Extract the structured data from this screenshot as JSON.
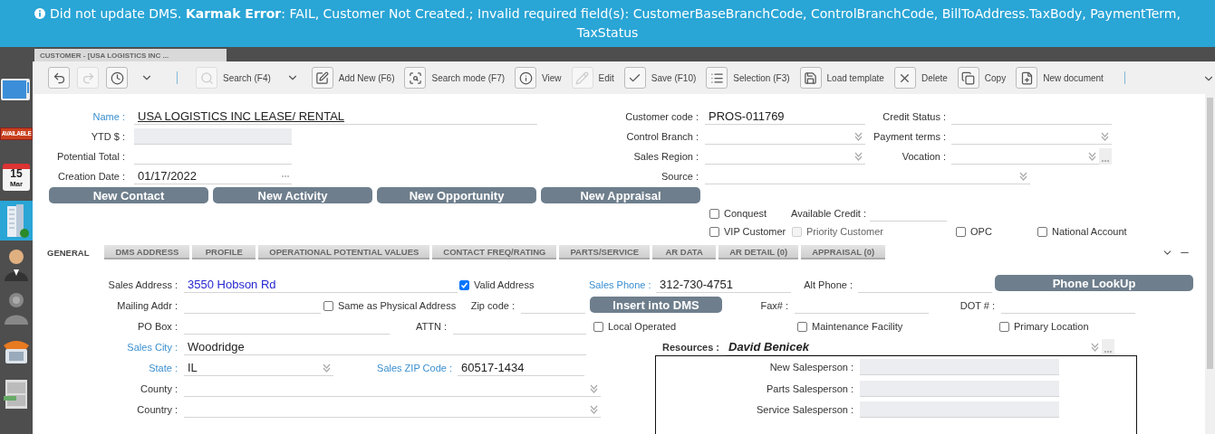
{
  "banner": {
    "message": "Did not update DMS. **Karmak Error**: FAIL, Customer Not Created.; Invalid required field(s): CustomerBaseBranchCode, ControlBranchCode, BillToAddress.TaxBody, PaymentTerm, TaxStatus"
  },
  "document_tab": {
    "title": "CUSTOMER - [USA LOGISTICS INC ..."
  },
  "sidebar": {
    "items": [
      {
        "kind": "monitor",
        "selected": false
      },
      {
        "kind": "sign",
        "text": "AVAILABLE",
        "selected": false
      },
      {
        "kind": "calendar",
        "day": "15",
        "month": "Mar",
        "selected": false
      },
      {
        "kind": "building",
        "selected": true
      },
      {
        "kind": "person",
        "selected": false
      },
      {
        "kind": "help",
        "selected": false
      },
      {
        "kind": "phone",
        "selected": false
      },
      {
        "kind": "cabinet",
        "selected": false
      }
    ]
  },
  "toolbar": {
    "items": [
      {
        "kind": "icon",
        "disabled": false
      },
      {
        "kind": "icon",
        "disabled": true
      },
      {
        "kind": "icon",
        "disabled": false
      },
      {
        "kind": "dropdown"
      },
      {
        "kind": "separator"
      },
      {
        "kind": "button",
        "label": "Search (F4)",
        "disabled": true
      },
      {
        "kind": "dropdown"
      },
      {
        "kind": "button",
        "label": "Add New (F6)",
        "disabled": false
      },
      {
        "kind": "button",
        "label": "Search mode (F7)",
        "disabled": false
      },
      {
        "kind": "button",
        "label": "View",
        "disabled": false
      },
      {
        "kind": "button",
        "label": "Edit",
        "disabled": true
      },
      {
        "kind": "button",
        "label": "Save (F10)",
        "disabled": false
      },
      {
        "kind": "button",
        "label": "Selection (F3)",
        "disabled": false
      },
      {
        "kind": "button",
        "label": "Load template",
        "disabled": false
      },
      {
        "kind": "button",
        "label": "Delete",
        "disabled": false
      },
      {
        "kind": "button",
        "label": "Copy",
        "disabled": false
      },
      {
        "kind": "button",
        "label": "New document",
        "disabled": false
      },
      {
        "kind": "separator"
      }
    ]
  },
  "header": {
    "name": {
      "label": "Name :",
      "value": "USA LOGISTICS INC  LEASE/ RENTAL",
      "required": true
    },
    "customer_code": {
      "label": "Customer code :",
      "value": "PROS-011769",
      "required": false
    },
    "credit_status": {
      "label": "Credit Status :",
      "required": false
    },
    "ytd": {
      "label": "YTD $ :",
      "required": false
    },
    "control_branch": {
      "label": "Control Branch :",
      "required": false
    },
    "payment_terms": {
      "label": "Payment terms :",
      "required": false
    },
    "potential_total": {
      "label": "Potential Total :",
      "required": false
    },
    "sales_region": {
      "label": "Sales Region :",
      "required": false
    },
    "vocation": {
      "label": "Vocation :",
      "required": false
    },
    "creation_date": {
      "label": "Creation Date :",
      "value": "01/17/2022",
      "required": false
    },
    "source": {
      "label": "Source :",
      "required": false
    }
  },
  "action_buttons": [
    "New Contact",
    "New Activity",
    "New Opportunity",
    "New Appraisal"
  ],
  "flags": {
    "conquest": {
      "label": "Conquest",
      "checked": false,
      "disabled": false
    },
    "available_credit": {
      "label": "Available Credit :",
      "required": false
    },
    "vip_customer": {
      "label": "VIP Customer",
      "checked": false,
      "disabled": false
    },
    "priority_customer": {
      "label": "Priority Customer",
      "checked": false,
      "disabled": true
    },
    "opc": {
      "label": "OPC",
      "checked": false,
      "disabled": false
    },
    "national_account": {
      "label": "National Account",
      "checked": false,
      "disabled": false
    }
  },
  "tabs": [
    {
      "label": "GENERAL",
      "selected": true
    },
    {
      "label": "DMS ADDRESS",
      "selected": false
    },
    {
      "label": "PROFILE",
      "selected": false
    },
    {
      "label": "OPERATIONAL POTENTIAL VALUES",
      "selected": false
    },
    {
      "label": "CONTACT FREQ/RATING",
      "selected": false
    },
    {
      "label": "PARTS/SERVICE",
      "selected": false
    },
    {
      "label": "AR DATA",
      "selected": false
    },
    {
      "label": "AR DETAIL (0)",
      "selected": false
    },
    {
      "label": "APPRAISAL (0)",
      "selected": false
    }
  ],
  "general": {
    "sales_address": {
      "label": "Sales Address :",
      "value": "3550 Hobson Rd",
      "required": false
    },
    "valid_address": {
      "label": "Valid Address",
      "checked": true,
      "disabled": false
    },
    "sales_phone": {
      "label": "Sales Phone :",
      "value": "312-730-4751",
      "required": true
    },
    "alt_phone": {
      "label": "Alt Phone :",
      "required": false
    },
    "phone_lookup": {
      "label": "Phone LookUp"
    },
    "mailing_addr": {
      "label": "Mailing Addr :",
      "required": false
    },
    "same_as_physical": {
      "label": "Same as Physical Address",
      "checked": false,
      "disabled": false
    },
    "zip_code": {
      "label": "Zip code :",
      "required": false
    },
    "insert_into_dms": {
      "label": "Insert into DMS"
    },
    "fax": {
      "label": "Fax# :",
      "required": false
    },
    "dot": {
      "label": "DOT # :",
      "required": false
    },
    "po_box": {
      "label": "PO Box :",
      "required": false
    },
    "attn": {
      "label": "ATTN :",
      "required": false
    },
    "local_operated": {
      "label": "Local Operated",
      "checked": false,
      "disabled": false
    },
    "maintenance_facility": {
      "label": "Maintenance Facility",
      "checked": false,
      "disabled": false
    },
    "primary_location": {
      "label": "Primary Location",
      "checked": false,
      "disabled": false
    },
    "sales_city": {
      "label": "Sales City :",
      "value": "Woodridge",
      "required": true
    },
    "resources": {
      "label": "Resources :",
      "value": "David Benicek",
      "required": false
    },
    "state": {
      "label": "State :",
      "value": "IL",
      "required": true
    },
    "sales_zip_code": {
      "label": "Sales ZIP Code :",
      "value": "60517-1434",
      "required": true
    },
    "county": {
      "label": "County :",
      "required": false
    },
    "country": {
      "label": "Country :",
      "required": false
    }
  },
  "resources_panel": {
    "fields": [
      {
        "label": "New Salesperson :"
      },
      {
        "label": "Parts Salesperson :"
      },
      {
        "label": "Service Salesperson :"
      }
    ]
  }
}
